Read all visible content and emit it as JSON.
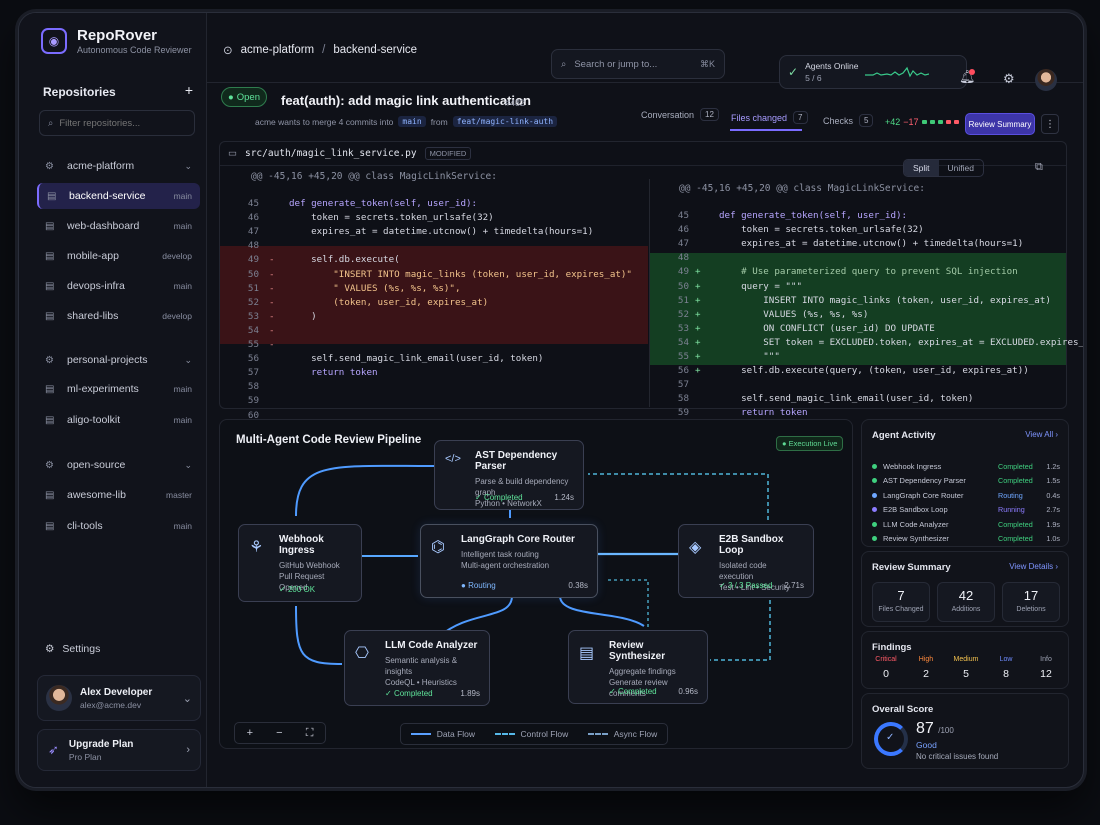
{
  "brand": {
    "name": "RepoRover",
    "tagline": "Autonomous Code Reviewer"
  },
  "sidebar": {
    "heading": "Repositories",
    "search_placeholder": "Filter repositories...",
    "groups": [
      {
        "label": "acme-platform",
        "items": [
          {
            "label": "backend-service",
            "branch": "main",
            "active": true
          },
          {
            "label": "web-dashboard",
            "branch": "main"
          },
          {
            "label": "mobile-app",
            "branch": "develop"
          },
          {
            "label": "devops-infra",
            "branch": "main"
          },
          {
            "label": "shared-libs",
            "branch": "develop"
          }
        ]
      },
      {
        "label": "personal-projects",
        "items": [
          {
            "label": "ml-experiments",
            "branch": "main"
          },
          {
            "label": "aligo-toolkit",
            "branch": "main"
          }
        ]
      },
      {
        "label": "open-source",
        "items": [
          {
            "label": "awesome-lib",
            "branch": "master"
          },
          {
            "label": "cli-tools",
            "branch": "main"
          }
        ]
      }
    ],
    "settings": "Settings",
    "user": {
      "name": "Alex Developer",
      "email": "alex@acme.dev"
    },
    "upgrade": {
      "title": "Upgrade Plan",
      "plan": "Pro Plan"
    }
  },
  "topbar": {
    "breadcrumb": [
      "acme-platform",
      "backend-service"
    ],
    "search_placeholder": "Search or jump to...",
    "shortcut": "⌘K",
    "agents": {
      "title": "Agents Online",
      "count": "5 / 6"
    }
  },
  "pr": {
    "status": "Open",
    "title": "feat(auth): add magic link authentication",
    "number": "#482",
    "subtitle": "acme wants to merge 4 commits into",
    "base": "main",
    "from_label": "from",
    "head": "feat/magic-link-auth",
    "tabs": [
      {
        "label": "Conversation",
        "count": "12"
      },
      {
        "label": "Files changed",
        "count": "7"
      },
      {
        "label": "Checks",
        "count": "5"
      }
    ],
    "additions": "+42",
    "deletions": "−17",
    "review_button": "Review Summary"
  },
  "diff": {
    "file": "src/auth/magic_link_service.py",
    "badge": "MODIFIED",
    "view_modes": [
      "Split",
      "Unified"
    ],
    "hunk": "@@ -45,16 +45,20 @@ class MagicLinkService:",
    "left": [
      {
        "n": "45",
        "m": "",
        "code": "def generate_token(self, user_id):"
      },
      {
        "n": "46",
        "m": "",
        "code": "    token = secrets.token_urlsafe(32)"
      },
      {
        "n": "47",
        "m": "",
        "code": "    expires_at = datetime.utcnow() + timedelta(hours=1)"
      },
      {
        "n": "48",
        "m": "",
        "code": ""
      },
      {
        "n": "49",
        "m": "-",
        "code": "    self.db.execute("
      },
      {
        "n": "50",
        "m": "-",
        "code": "        \"INSERT INTO magic_links (token, user_id, expires_at)\""
      },
      {
        "n": "51",
        "m": "-",
        "code": "        \" VALUES (%s, %s, %s)\","
      },
      {
        "n": "52",
        "m": "-",
        "code": "        (token, user_id, expires_at)"
      },
      {
        "n": "53",
        "m": "-",
        "code": "    )"
      },
      {
        "n": "54",
        "m": "-",
        "code": ""
      },
      {
        "n": "55",
        "m": "-",
        "code": ""
      },
      {
        "n": "56",
        "m": "",
        "code": "    self.send_magic_link_email(user_id, token)"
      },
      {
        "n": "57",
        "m": "",
        "code": "    return token"
      },
      {
        "n": "58",
        "m": "",
        "code": ""
      },
      {
        "n": "59",
        "m": "",
        "code": ""
      },
      {
        "n": "60",
        "m": "",
        "code": ""
      }
    ],
    "right": [
      {
        "n": "45",
        "m": "",
        "code": "def generate_token(self, user_id):"
      },
      {
        "n": "46",
        "m": "",
        "code": "    token = secrets.token_urlsafe(32)"
      },
      {
        "n": "47",
        "m": "",
        "code": "    expires_at = datetime.utcnow() + timedelta(hours=1)"
      },
      {
        "n": "48",
        "m": "",
        "code": ""
      },
      {
        "n": "49",
        "m": "+",
        "code": "    # Use parameterized query to prevent SQL injection"
      },
      {
        "n": "50",
        "m": "+",
        "code": "    query = \"\"\""
      },
      {
        "n": "51",
        "m": "+",
        "code": "        INSERT INTO magic_links (token, user_id, expires_at)"
      },
      {
        "n": "52",
        "m": "+",
        "code": "        VALUES (%s, %s, %s)"
      },
      {
        "n": "53",
        "m": "+",
        "code": "        ON CONFLICT (user_id) DO UPDATE"
      },
      {
        "n": "54",
        "m": "+",
        "code": "        SET token = EXCLUDED.token, expires_at = EXCLUDED.expires_at"
      },
      {
        "n": "55",
        "m": "+",
        "code": "        \"\"\""
      },
      {
        "n": "56",
        "m": "+",
        "code": "    self.db.execute(query, (token, user_id, expires_at))"
      },
      {
        "n": "57",
        "m": "",
        "code": ""
      },
      {
        "n": "58",
        "m": "",
        "code": "    self.send_magic_link_email(user_id, token)"
      },
      {
        "n": "59",
        "m": "",
        "code": "    return token"
      },
      {
        "n": "60",
        "m": "",
        "code": ""
      }
    ]
  },
  "pipeline": {
    "title": "Multi-Agent Code Review Pipeline",
    "badge": "Execution Live",
    "nodes": {
      "ast": {
        "title": "AST Dependency Parser",
        "desc1": "Parse & build dependency graph",
        "desc2": "Python • NetworkX",
        "status": "Completed",
        "time": "1.24s"
      },
      "webhook": {
        "title": "Webhook Ingress",
        "desc1": "GitHub Webhook",
        "desc2": "Pull Request Opened",
        "status": "200 OK",
        "time": ""
      },
      "router": {
        "title": "LangGraph Core Router",
        "desc1": "Intelligent task routing",
        "desc2": "Multi-agent orchestration",
        "status": "Routing",
        "time": "0.38s"
      },
      "sandbox": {
        "title": "E2B Sandbox Loop",
        "desc1": "Isolated code execution",
        "desc2": "Test • Lint • Security",
        "status": "3 / 3 Passed",
        "time": "2.71s"
      },
      "llm": {
        "title": "LLM Code Analyzer",
        "desc1": "Semantic analysis & insights",
        "desc2": "CodeQL • Heuristics",
        "status": "Completed",
        "time": "1.89s"
      },
      "synth": {
        "title": "Review Synthesizer",
        "desc1": "Aggregate findings",
        "desc2": "Generate review comments",
        "status": "Completed",
        "time": "0.96s"
      }
    },
    "legend": [
      "Data Flow",
      "Control Flow",
      "Async Flow"
    ]
  },
  "activity": {
    "title": "Agent Activity",
    "link": "View All ›",
    "rows": [
      {
        "name": "Webhook Ingress",
        "status": "Completed",
        "time": "1.2s",
        "color": "#3fd07f"
      },
      {
        "name": "AST Dependency Parser",
        "status": "Completed",
        "time": "1.5s",
        "color": "#3fd07f"
      },
      {
        "name": "LangGraph Core Router",
        "status": "Routing",
        "time": "0.4s",
        "color": "#6fa7ff"
      },
      {
        "name": "E2B Sandbox Loop",
        "status": "Running",
        "time": "2.7s",
        "color": "#8c7cff"
      },
      {
        "name": "LLM Code Analyzer",
        "status": "Completed",
        "time": "1.9s",
        "color": "#3fd07f"
      },
      {
        "name": "Review Synthesizer",
        "status": "Completed",
        "time": "1.0s",
        "color": "#3fd07f"
      }
    ]
  },
  "summary": {
    "title": "Review Summary",
    "link": "View Details ›",
    "files": {
      "value": "7",
      "label": "Files Changed"
    },
    "additions": {
      "value": "42",
      "label": "Additions"
    },
    "deletions": {
      "value": "17",
      "label": "Deletions"
    }
  },
  "findings": {
    "title": "Findings",
    "items": [
      {
        "label": "Critical",
        "value": "0",
        "color": "#ff5a67"
      },
      {
        "label": "High",
        "value": "2",
        "color": "#ff8a3d"
      },
      {
        "label": "Medium",
        "value": "5",
        "color": "#f2c14e"
      },
      {
        "label": "Low",
        "value": "8",
        "color": "#6f8cff"
      },
      {
        "label": "Info",
        "value": "12",
        "color": "#9ea3b4"
      }
    ]
  },
  "score": {
    "title": "Overall Score",
    "value": "87",
    "max": "/100",
    "grade": "Good",
    "note": "No critical issues found"
  }
}
